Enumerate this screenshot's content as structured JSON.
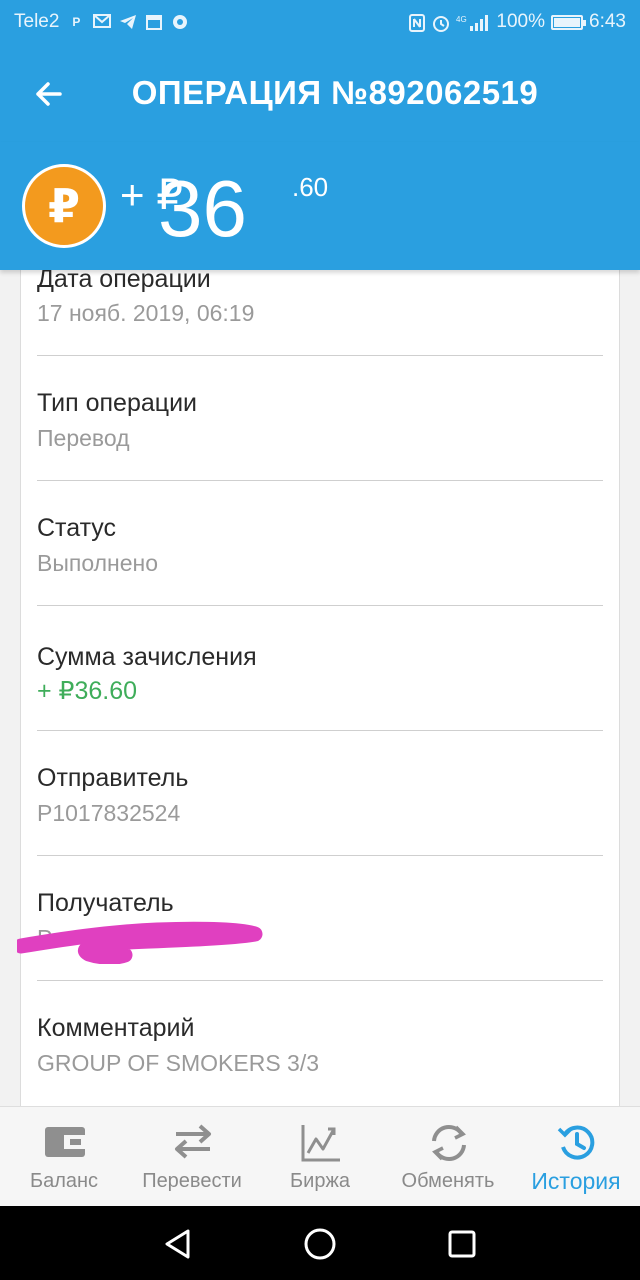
{
  "status_bar": {
    "carrier": "Tele2",
    "notification_icons": [
      "p-icon",
      "gmail-icon",
      "telegram-icon",
      "calendar-icon",
      "chrome-icon"
    ],
    "system_icons": [
      "nfc-icon",
      "alarm-icon",
      "signal-4g-icon"
    ],
    "battery_percent": "100%",
    "battery_level": 1.0,
    "time": "6:43"
  },
  "header": {
    "title": "ОПЕРАЦИЯ №892062519"
  },
  "amount": {
    "coin_symbol": "₽",
    "prefix": "+ ₽",
    "integer": "36",
    "cents": ".60"
  },
  "details": [
    {
      "label": "Дата операции",
      "value": "17 нояб. 2019, 06:19"
    },
    {
      "label": "Тип операции",
      "value": "Перевод"
    },
    {
      "label": "Статус",
      "value": "Выполнено"
    },
    {
      "label": "Сумма зачисления",
      "value": "+ ₽36.60"
    },
    {
      "label": "Отправитель",
      "value": "P1017832524"
    },
    {
      "label": "Получатель",
      "value": "P"
    },
    {
      "label": "Комментарий",
      "value": "GROUP OF SMOKERS 3/3"
    }
  ],
  "bottom_nav": [
    {
      "label": "Баланс",
      "icon": "wallet-icon"
    },
    {
      "label": "Перевести",
      "icon": "transfer-icon"
    },
    {
      "label": "Биржа",
      "icon": "chart-icon"
    },
    {
      "label": "Обменять",
      "icon": "exchange-icon"
    },
    {
      "label": "История",
      "icon": "history-icon",
      "active": true
    }
  ],
  "colors": {
    "primary": "#2a9fe0",
    "coin": "#f39a1e",
    "positive": "#3fad5a",
    "redaction": "#e040c0"
  }
}
